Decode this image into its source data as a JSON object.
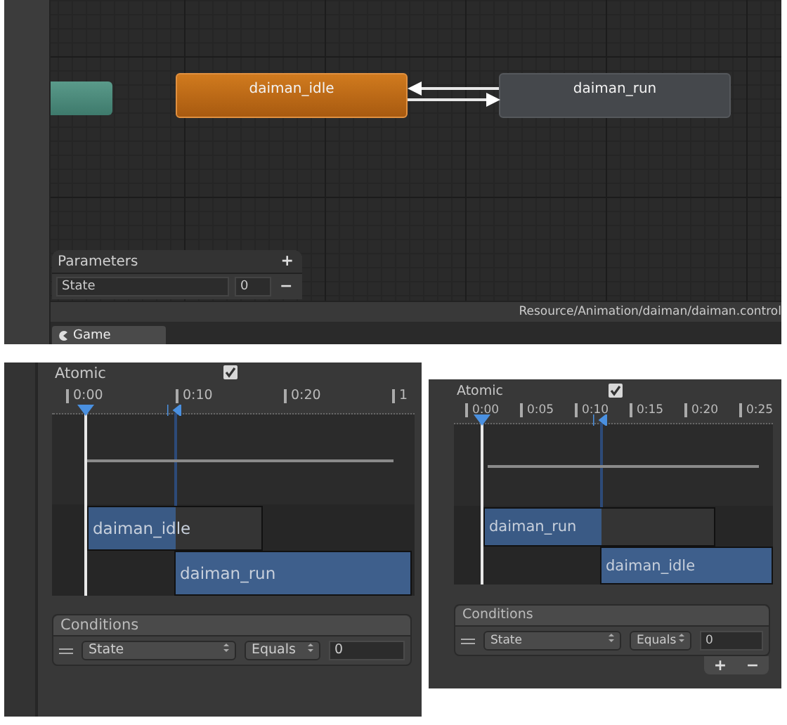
{
  "animator": {
    "nodes": [
      {
        "kind": "entry"
      },
      {
        "kind": "default",
        "label": "daiman_idle"
      },
      {
        "kind": "state",
        "label": "daiman_run"
      }
    ],
    "parameters": {
      "title": "Parameters",
      "add": "+",
      "items": [
        {
          "name": "State",
          "value": "0",
          "remove": "−"
        }
      ]
    },
    "status_bar": {
      "path": "Resource/Animation/daiman/daiman.control"
    },
    "tabs": [
      {
        "label": "Game",
        "selected": true
      }
    ]
  },
  "transition_inspectors": [
    {
      "atomic": {
        "label": "Atomic",
        "checked": true
      },
      "ruler": [
        "0:00",
        "0:10",
        "0:20",
        "1"
      ],
      "clips": [
        {
          "label": "daiman_idle"
        },
        {
          "label": "daiman_run"
        }
      ],
      "conditions": {
        "title": "Conditions",
        "rows": [
          {
            "parameter": "State",
            "mode": "Equals",
            "value": "0"
          }
        ]
      }
    },
    {
      "atomic": {
        "label": "Atomic",
        "checked": true
      },
      "ruler": [
        "0:00",
        "0:05",
        "0:10",
        "0:15",
        "0:20",
        "0:25"
      ],
      "clips": [
        {
          "label": "daiman_run"
        },
        {
          "label": "daiman_idle"
        }
      ],
      "conditions": {
        "title": "Conditions",
        "rows": [
          {
            "parameter": "State",
            "mode": "Equals",
            "value": "0"
          }
        ],
        "buttons": [
          "+",
          "−"
        ]
      }
    }
  ]
}
